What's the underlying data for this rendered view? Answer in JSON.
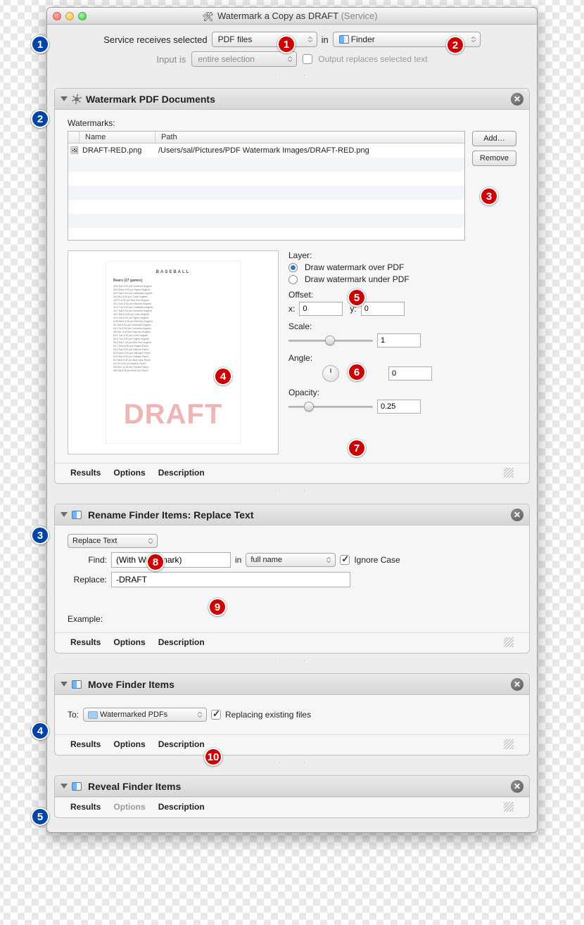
{
  "window": {
    "title": "Watermark a Copy as DRAFT",
    "title_suffix": "(Service)"
  },
  "service": {
    "receives_label": "Service receives selected",
    "type_value": "PDF files",
    "in_label": "in",
    "app_value": "Finder",
    "input_is_label": "Input is",
    "input_is_value": "entire selection",
    "output_replaces_label": "Output replaces selected text",
    "output_replaces_checked": false
  },
  "actions": [
    {
      "title": "Watermark PDF Documents",
      "watermarks_label": "Watermarks:",
      "columns": {
        "name": "Name",
        "path": "Path"
      },
      "rows": [
        {
          "name": "DRAFT-RED.png",
          "path": "/Users/sal/Pictures/PDF Watermark Images/DRAFT-RED.png"
        }
      ],
      "buttons": {
        "add": "Add…",
        "remove": "Remove"
      },
      "layer_label": "Layer:",
      "layer_over": "Draw watermark over PDF",
      "layer_under": "Draw watermark under PDF",
      "layer_selected": "over",
      "offset_label": "Offset:",
      "offset": {
        "x_label": "x:",
        "x": "0",
        "y_label": "y:",
        "y": "0"
      },
      "scale_label": "Scale:",
      "scale_value": "1",
      "angle_label": "Angle:",
      "angle_value": "0",
      "opacity_label": "Opacity:",
      "opacity_value": "0.25",
      "preview_draft": "DRAFT",
      "preview_heading": "BASEBALL",
      "preview_sub": "Bears (27 games)"
    },
    {
      "title": "Rename Finder Items: Replace Text",
      "mode_value": "Replace Text",
      "find_label": "Find:",
      "find_value": "(With Watermark)",
      "in_label": "in",
      "in_value": "full name",
      "ignore_case_label": "Ignore Case",
      "ignore_case_checked": true,
      "replace_label": "Replace:",
      "replace_value": "-DRAFT",
      "example_label": "Example:"
    },
    {
      "title": "Move Finder Items",
      "to_label": "To:",
      "to_value": "Watermarked PDFs",
      "replacing_label": "Replacing existing files",
      "replacing_checked": true
    },
    {
      "title": "Reveal Finder Items"
    }
  ],
  "footer": {
    "results": "Results",
    "options": "Options",
    "description": "Description"
  },
  "annotations": {
    "blue": [
      "1",
      "2",
      "3",
      "4",
      "5"
    ],
    "red": [
      "1",
      "2",
      "3",
      "4",
      "5",
      "6",
      "7",
      "8",
      "9",
      "10"
    ]
  }
}
